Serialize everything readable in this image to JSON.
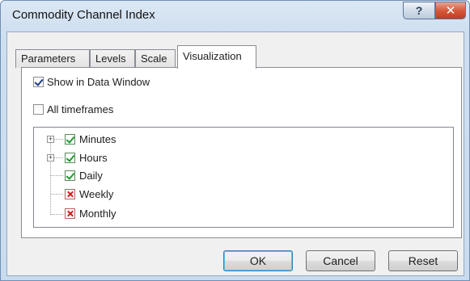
{
  "window": {
    "title": "Commodity Channel Index",
    "help_label": "?",
    "close_label": "✕"
  },
  "tabs": [
    {
      "label": "Parameters"
    },
    {
      "label": "Levels"
    },
    {
      "label": "Scale"
    },
    {
      "label": "Visualization",
      "active": true
    }
  ],
  "options": {
    "show_in_data_window": {
      "label": "Show in Data Window",
      "checked": true
    },
    "all_timeframes": {
      "label": "All timeframes",
      "checked": false
    }
  },
  "timeframes": [
    {
      "label": "Minutes",
      "enabled": true,
      "expandable": true
    },
    {
      "label": "Hours",
      "enabled": true,
      "expandable": true
    },
    {
      "label": "Daily",
      "enabled": true,
      "expandable": false
    },
    {
      "label": "Weekly",
      "enabled": false,
      "expandable": false
    },
    {
      "label": "Monthly",
      "enabled": false,
      "expandable": false
    }
  ],
  "buttons": {
    "ok": "OK",
    "cancel": "Cancel",
    "reset": "Reset"
  },
  "icons": {
    "help": "help-icon",
    "close": "close-icon",
    "expand": "plus-icon",
    "enabled": "green-check-icon",
    "disabled": "red-x-icon"
  }
}
